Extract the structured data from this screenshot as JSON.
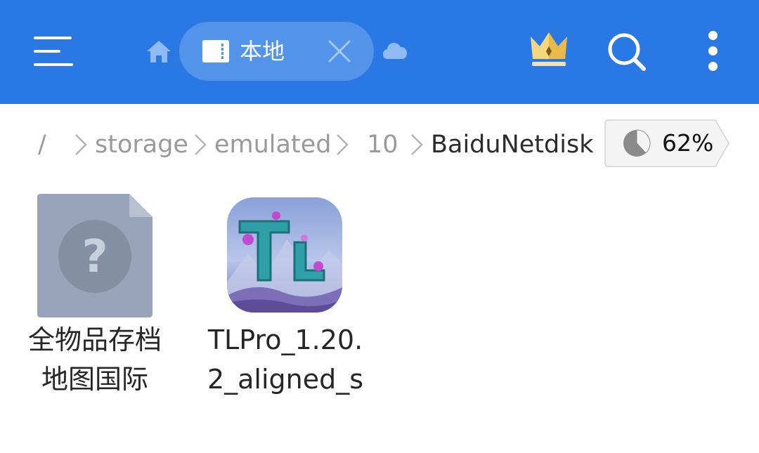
{
  "toolbar": {
    "tab_label": "本地",
    "accent_color": "#2a78e4",
    "icons": [
      "menu-icon",
      "home-icon",
      "sd-card-icon",
      "close-icon",
      "cloud-icon",
      "crown-icon",
      "search-icon",
      "more-vertical-icon"
    ]
  },
  "breadcrumb": {
    "items": [
      {
        "label": "/"
      },
      {
        "label": "storage"
      },
      {
        "label": "emulated"
      },
      {
        "label": "10"
      },
      {
        "label": "BaiduNetdisk"
      }
    ]
  },
  "storage": {
    "usage_label": "62%",
    "usage_fraction": 0.62
  },
  "files": [
    {
      "name": "全物品存档\n地图国际",
      "type": "unknown",
      "icon": "unknown-file-icon"
    },
    {
      "name": "TLPro_1.20.\n2_aligned_s",
      "type": "apk",
      "icon": "app-icon",
      "app_icon_text": "TL"
    }
  ]
}
